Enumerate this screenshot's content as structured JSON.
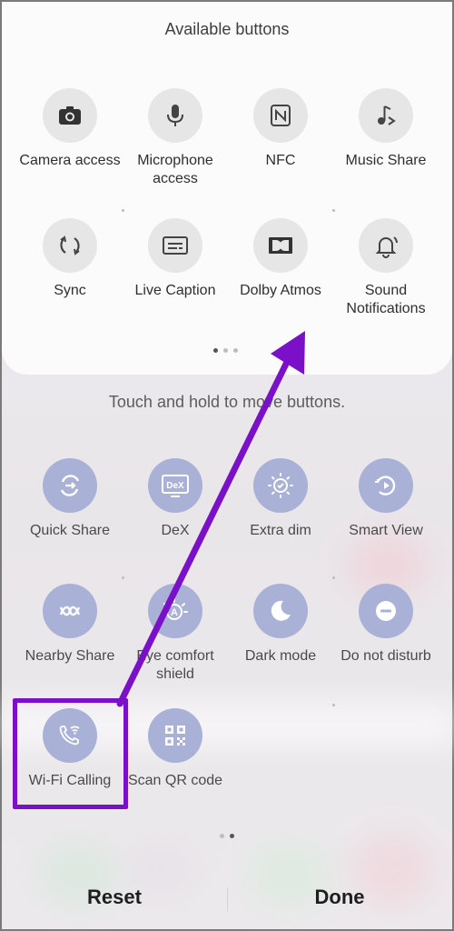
{
  "available_panel": {
    "title": "Available buttons",
    "buttons": [
      {
        "label": "Camera access",
        "icon": "camera-icon"
      },
      {
        "label": "Microphone access",
        "icon": "microphone-icon"
      },
      {
        "label": "NFC",
        "icon": "nfc-icon"
      },
      {
        "label": "Music Share",
        "icon": "music-share-icon"
      },
      {
        "label": "Sync",
        "icon": "sync-icon"
      },
      {
        "label": "Live Caption",
        "icon": "live-caption-icon"
      },
      {
        "label": "Dolby Atmos",
        "icon": "dolby-atmos-icon"
      },
      {
        "label": "Sound Notifications",
        "icon": "sound-notifications-icon"
      }
    ],
    "page_indicator": {
      "pages": 3,
      "current": 1
    }
  },
  "hint": "Touch and hold to move buttons.",
  "active_panel": {
    "buttons": [
      {
        "label": "Quick Share",
        "icon": "quick-share-icon"
      },
      {
        "label": "DeX",
        "icon": "dex-icon"
      },
      {
        "label": "Extra dim",
        "icon": "extra-dim-icon"
      },
      {
        "label": "Smart View",
        "icon": "smart-view-icon"
      },
      {
        "label": "Nearby Share",
        "icon": "nearby-share-icon"
      },
      {
        "label": "Eye comfort shield",
        "icon": "eye-comfort-shield-icon"
      },
      {
        "label": "Dark mode",
        "icon": "dark-mode-icon"
      },
      {
        "label": "Do not disturb",
        "icon": "do-not-disturb-icon"
      },
      {
        "label": "Wi-Fi Calling",
        "icon": "wifi-calling-icon"
      },
      {
        "label": "Scan QR code",
        "icon": "scan-qr-icon"
      }
    ],
    "page_indicator": {
      "pages": 2,
      "current": 2
    }
  },
  "actions": {
    "reset": "Reset",
    "done": "Done"
  },
  "annotation": {
    "highlight_color": "#7a10c7",
    "arrow_color": "#7a10c7"
  },
  "colors": {
    "active_tile": "#a9b1d6",
    "inactive_tile": "#e6e6e6"
  }
}
